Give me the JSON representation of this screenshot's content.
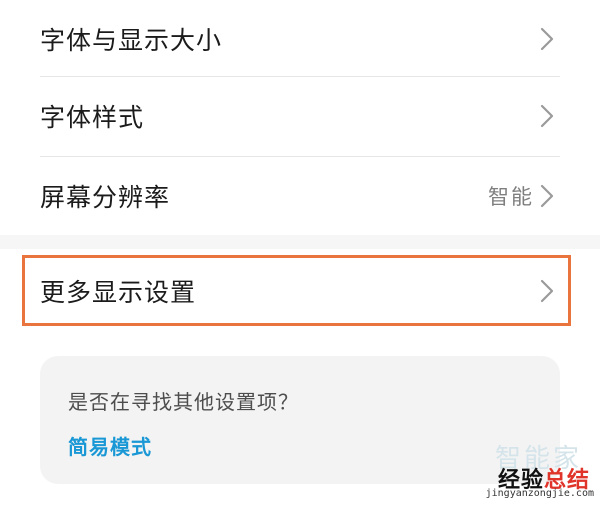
{
  "settings": {
    "rows": [
      {
        "label": "字体与显示大小",
        "value": ""
      },
      {
        "label": "字体样式",
        "value": ""
      },
      {
        "label": "屏幕分辨率",
        "value": "智能"
      },
      {
        "label": "更多显示设置",
        "value": ""
      }
    ]
  },
  "suggestion": {
    "question": "是否在寻找其他设置项？",
    "link": "简易模式"
  },
  "watermark": {
    "faint": "智能家",
    "main_part1": "经验",
    "main_part2": "总结",
    "url": "jingyanzongjie.com"
  },
  "colors": {
    "highlight": "#e9743e",
    "link": "#1a98d6",
    "card_bg": "#f3f3f3",
    "value_text": "#7f7f7f"
  },
  "icons": {
    "row_arrow": "chevron-right-icon"
  }
}
